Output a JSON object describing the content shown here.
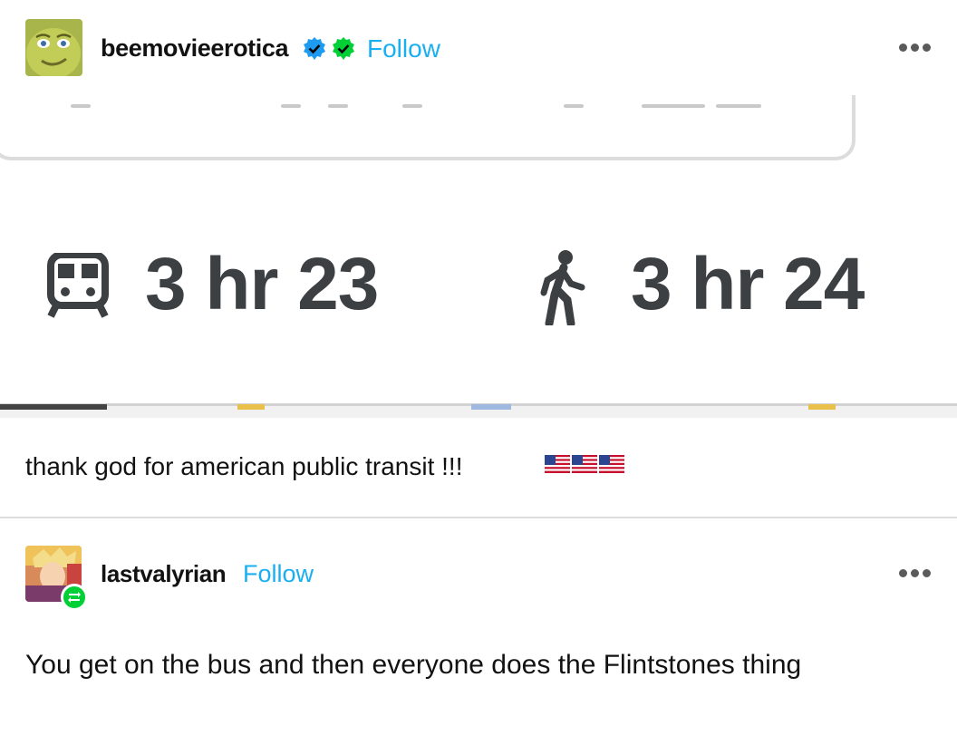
{
  "post": {
    "username": "beemovieerotica",
    "follow_label": "Follow",
    "caption": "thank god for american public transit !!!",
    "caption_emoji": [
      "flag-us",
      "flag-us",
      "flag-us"
    ],
    "screenshot": {
      "transit_time": "3 hr 23",
      "walk_time": "3 hr 24",
      "transit_icon": "train-icon",
      "walk_icon": "walking-person-icon"
    }
  },
  "reblog": {
    "username": "lastvalyrian",
    "follow_label": "Follow",
    "text": "You get on the bus and then everyone does the Flintstones thing"
  },
  "colors": {
    "follow": "#1aaff0",
    "verified_blue": "#1d9bf0",
    "verified_green": "#00cf35",
    "time_text": "#3c4043"
  }
}
